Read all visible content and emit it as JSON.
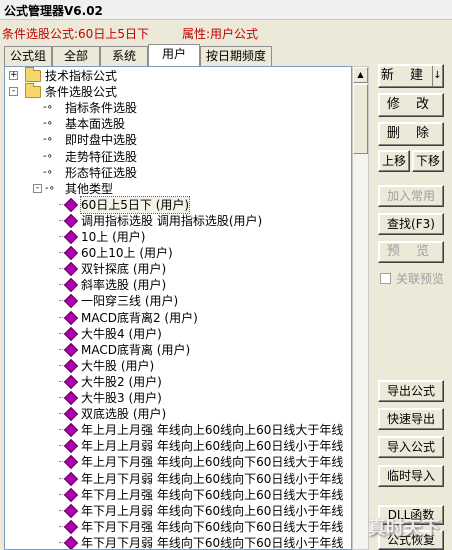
{
  "window": {
    "title": "公式管理器V6.02"
  },
  "info": {
    "condition": "条件选股公式:60日上5日下",
    "attribute": "属性:用户公式"
  },
  "tabs": [
    "公式组",
    "全部",
    "系统",
    "用户",
    "按日期频度"
  ],
  "tree": [
    {
      "label": "技术指标公式",
      "icon": "folder-icon",
      "expander": "+"
    },
    {
      "label": "条件选股公式",
      "icon": "folder-icon",
      "expander": "-"
    },
    {
      "label": "指标条件选股",
      "icon": "key-icon"
    },
    {
      "label": "基本面选股",
      "icon": "key-icon"
    },
    {
      "label": "即时盘中选股",
      "icon": "key-icon"
    },
    {
      "label": "走势特征选股",
      "icon": "key-icon"
    },
    {
      "label": "形态特征选股",
      "icon": "key-icon"
    },
    {
      "label": "其他类型",
      "icon": "key-icon",
      "expander": "-"
    },
    {
      "label": "60日上5日下   (用户)",
      "icon": "formula-gem-icon",
      "selected": true
    },
    {
      "label": "调用指标选股   调用指标选股(用户)",
      "icon": "formula-gem-icon"
    },
    {
      "label": "10上   (用户)",
      "icon": "formula-gem-icon"
    },
    {
      "label": "60上10上   (用户)",
      "icon": "formula-gem-icon"
    },
    {
      "label": "双针探底   (用户)",
      "icon": "formula-gem-icon"
    },
    {
      "label": "斜率选股   (用户)",
      "icon": "formula-gem-icon"
    },
    {
      "label": "一阳穿三线   (用户)",
      "icon": "formula-gem-icon"
    },
    {
      "label": "MACD底背离2   (用户)",
      "icon": "formula-gem-icon"
    },
    {
      "label": "大牛股4   (用户)",
      "icon": "formula-gem-icon"
    },
    {
      "label": "MACD底背离   (用户)",
      "icon": "formula-gem-icon"
    },
    {
      "label": "大牛股   (用户)",
      "icon": "formula-gem-icon"
    },
    {
      "label": "大牛股2   (用户)",
      "icon": "formula-gem-icon"
    },
    {
      "label": "大牛股3   (用户)",
      "icon": "formula-gem-icon"
    },
    {
      "label": "双底选股   (用户)",
      "icon": "formula-gem-icon"
    },
    {
      "label": "年上月上月强   年线向上60线向上60日线大于年线",
      "icon": "formula-gem-icon"
    },
    {
      "label": "年上月上月弱   年线向上60线向上60日线小于年线",
      "icon": "formula-gem-icon"
    },
    {
      "label": "年上月下月强   年线向上60线向下60日线大于年线",
      "icon": "formula-gem-icon"
    },
    {
      "label": "年上月下月弱   年线向上60线向下60日线小于年线",
      "icon": "formula-gem-icon"
    },
    {
      "label": "年下月上月强   年线向下60线向上60日线大于年线",
      "icon": "formula-gem-icon"
    },
    {
      "label": "年下月上月弱   年线向下60线向上60日线小于年线",
      "icon": "formula-gem-icon"
    },
    {
      "label": "年下月下月强   年线向下60线向下60日线大于年线",
      "icon": "formula-gem-icon"
    },
    {
      "label": "年下月下月弱   年线向下60线向下60日线小于年线",
      "icon": "formula-gem-icon"
    }
  ],
  "buttons": {
    "new": "新 建",
    "new_arrow": "↓",
    "edit": "修 改",
    "delete": "删 除",
    "move_up": "上移",
    "move_down": "下移",
    "add_common": "加入常用",
    "find": "查找(F3)",
    "preview": "预 览",
    "related_preview": "关联预览",
    "export": "导出公式",
    "quick_export": "快速导出",
    "import": "导入公式",
    "temp_import": "临时导入",
    "dll": "DLL函数",
    "restore": "公式恢复"
  },
  "watermark": "真时天下"
}
